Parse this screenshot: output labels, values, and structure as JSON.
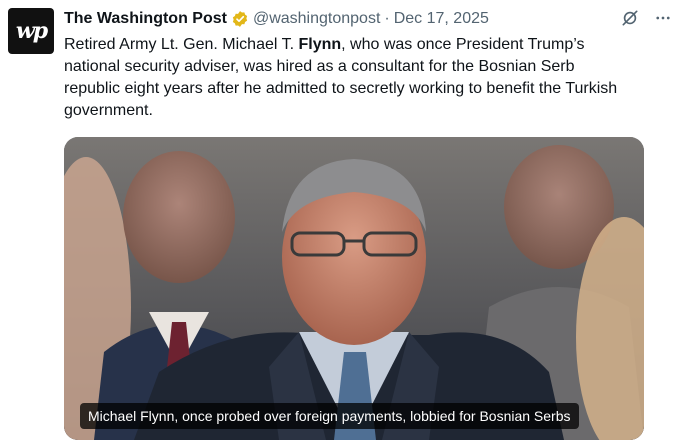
{
  "tweet": {
    "author_name": "The Washington Post",
    "handle": "@washingtonpost",
    "separator": "·",
    "date": "Dec 17, 2025",
    "text_before": "Retired Army Lt. Gen. Michael T. ",
    "text_bold": "Flynn",
    "text_after": ", who was once President Trump’s national security adviser, was hired as a consultant for the Bosnian Serb republic eight years after he admitted to secretly working to benefit the Turkish government.",
    "avatar_letters": "wp",
    "media_caption": "Michael Flynn, once probed over foreign payments, lobbied for Bosnian Serbs"
  },
  "icons": {
    "verified": "verified-badge-icon",
    "grok": "grok-icon",
    "more": "more-options-icon"
  },
  "colors": {
    "verified_gold": "#e2b719",
    "secondary_text": "#536471"
  }
}
